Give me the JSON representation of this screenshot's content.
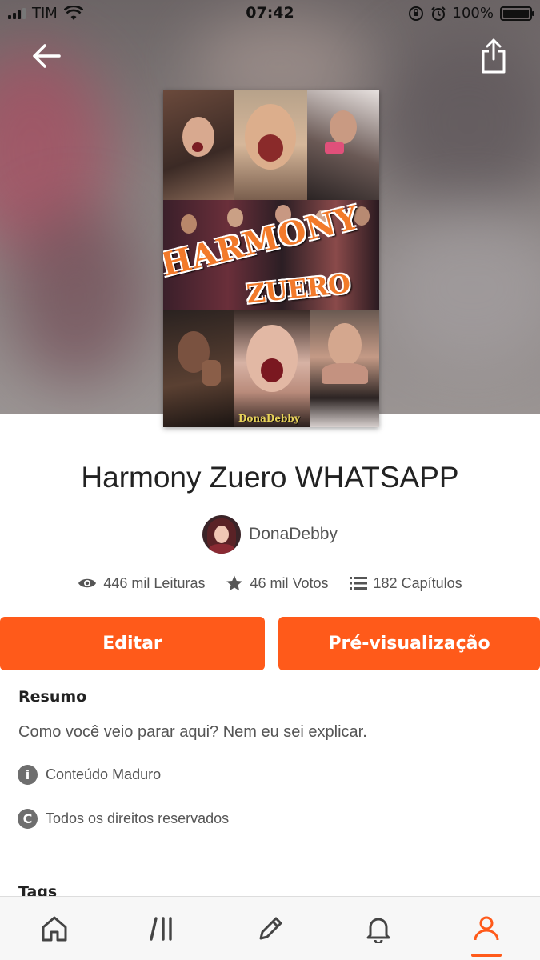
{
  "status_bar": {
    "carrier": "TIM",
    "time": "07:42",
    "battery": "100%",
    "battery_level": 1.0
  },
  "cover_art": {
    "title_line1": "HARMONY",
    "title_line2": "ZUERO",
    "signature": "DonaDebby"
  },
  "story": {
    "title": "Harmony Zuero WHATSAPP",
    "author": "DonaDebby"
  },
  "stats": {
    "reads": "446 mil Leituras",
    "votes": "46 mil Votos",
    "chapters": "182 Capítulos"
  },
  "actions": {
    "edit_label": "Editar",
    "preview_label": "Pré-visualização"
  },
  "summary": {
    "label": "Resumo",
    "text": "Como você veio parar aqui? Nem eu sei explicar."
  },
  "meta": {
    "rating": "Conteúdo Maduro",
    "rating_icon_glyph": "i",
    "copyright": "Todos os direitos reservados",
    "copyright_icon_glyph": "C"
  },
  "tags_label": "Tags",
  "nav": {
    "items": [
      "home-icon",
      "library-icon",
      "write-icon",
      "notifications-icon",
      "profile-icon"
    ],
    "active": "profile"
  },
  "colors": {
    "accent": "#ff5a1a",
    "text_primary": "#222222",
    "text_secondary": "#555555"
  }
}
